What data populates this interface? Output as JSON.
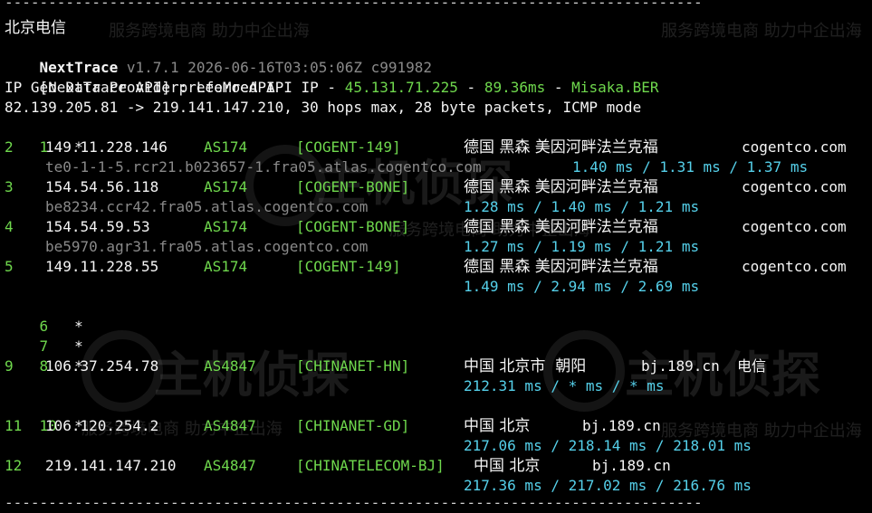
{
  "separator": "--------------------------------------------------------------------------------",
  "header_label": "北京电信",
  "watermark_text": "服务跨境电商 助力中企出海",
  "watermark_big": "主机侦探",
  "nexttrace": {
    "name": "NextTrace",
    "version_info": " v1.7.1 2026-06-16T03:05:06Z c991982",
    "api_label": "[NextTrace API]",
    "api_text": " preferred API IP - ",
    "api_ip": "45.131.71.225",
    "api_dash": " - ",
    "api_latency": "89.36ms",
    "api_dash2": " - ",
    "api_node": "Misaka.BER",
    "geo_provider": "IP Geo Data Provider: LeoMoeAPI",
    "route": "82.139.205.81 -> 219.141.147.210, 30 hops max, 28 byte packets, ICMP mode"
  },
  "hops": [
    {
      "num": "1",
      "star": "*"
    },
    {
      "num": "2",
      "ip": "149.11.228.146",
      "asn": "AS174",
      "tag": "[COGENT-149]",
      "geo": "德国 黑森 美因河畔法兰克福",
      "host": "cogentco.com",
      "rdns": "te0-1-1-5.rcr21.b023657-1.fra05.atlas.cogentco.com",
      "rtt": "1.40 ms / 1.31 ms / 1.37 ms"
    },
    {
      "num": "3",
      "ip": "154.54.56.118",
      "asn": "AS174",
      "tag": "[COGENT-BONE]",
      "geo": "德国 黑森 美因河畔法兰克福",
      "host": "cogentco.com",
      "rdns": "be8234.ccr42.fra05.atlas.cogentco.com",
      "rtt": "1.28 ms / 1.40 ms / 1.21 ms"
    },
    {
      "num": "4",
      "ip": "154.54.59.53",
      "asn": "AS174",
      "tag": "[COGENT-BONE]",
      "geo": "德国 黑森 美因河畔法兰克福",
      "host": "cogentco.com",
      "rdns": "be5970.agr31.fra05.atlas.cogentco.com",
      "rtt": "1.27 ms / 1.19 ms / 1.21 ms"
    },
    {
      "num": "5",
      "ip": "149.11.228.55",
      "asn": "AS174",
      "tag": "[COGENT-149]",
      "geo": "德国 黑森 美因河畔法兰克福",
      "host": "cogentco.com",
      "rtt": "1.49 ms / 2.94 ms / 2.69 ms"
    },
    {
      "num": "6",
      "star": "*"
    },
    {
      "num": "7",
      "star": "*"
    },
    {
      "num": "8",
      "star": "*"
    },
    {
      "num": "9",
      "ip": "106.37.254.78",
      "asn": "AS4847",
      "tag": "[CHINANET-HN]",
      "geo": "中国 北京市  朝阳",
      "host": "bj.189.cn  电信",
      "rtt": "212.31 ms / * ms / * ms"
    },
    {
      "num": "10",
      "star": "*"
    },
    {
      "num": "11",
      "ip": "106.120.254.2",
      "asn": "AS4847",
      "tag": "[CHINANET-GD]",
      "geo": "中国 北京",
      "host": "bj.189.cn",
      "rtt": "217.06 ms / 218.14 ms / 218.01 ms"
    },
    {
      "num": "12",
      "ip": "219.141.147.210",
      "asn": "AS4847",
      "tag": "[CHINATELECOM-BJ]",
      "geo": "中国 北京",
      "host": "bj.189.cn",
      "rtt": "217.36 ms / 217.02 ms / 216.76 ms"
    }
  ],
  "colors": {
    "green": "#6fd84d",
    "cyan": "#55d0ea",
    "grey": "#8a8a8a",
    "background": "#000000"
  }
}
